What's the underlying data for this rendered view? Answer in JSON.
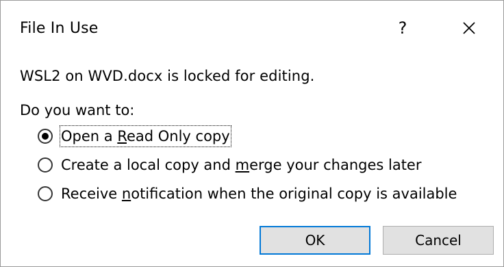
{
  "window": {
    "title": "File In Use",
    "help_label": "?",
    "close_icon": "close-icon"
  },
  "message": "WSL2 on WVD.docx is locked for editing.",
  "question": "Do you want to:",
  "options": [
    {
      "before": "Open a ",
      "mnemonic": "R",
      "after": "ead Only copy",
      "selected": true
    },
    {
      "before": "Create a local copy and ",
      "mnemonic": "m",
      "after": "erge your changes later",
      "selected": false
    },
    {
      "before": "Receive ",
      "mnemonic": "n",
      "after": "otification when the original copy is available",
      "selected": false
    }
  ],
  "buttons": {
    "ok_label": "OK",
    "cancel_label": "Cancel"
  },
  "colors": {
    "default_button_border": "#0078d7",
    "button_face": "#e1e1e1"
  }
}
